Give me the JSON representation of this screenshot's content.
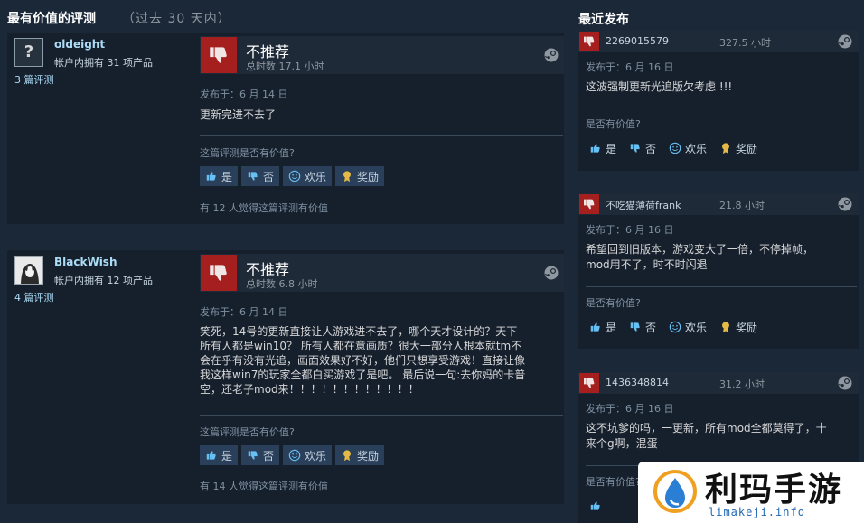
{
  "helpful_section": {
    "title": "最有价值的评测",
    "subtitle": "（过去 30 天内）"
  },
  "recent_section": {
    "title": "最近发布"
  },
  "reviews": [
    {
      "author": "oldeight",
      "owned": "帐户内拥有 31 项产品",
      "review_count": "3 篇评测",
      "avatar_text": "?",
      "recommendation": "不推荐",
      "hours": "总时数 17.1 小时",
      "posted": "发布于：6 月 14 日",
      "text": "更新完进不去了",
      "helpful_question": "这篇评测是否有价值?",
      "btn_yes": "是",
      "btn_no": "否",
      "btn_funny": "欢乐",
      "btn_award": "奖励",
      "helpful_count": "有 12 人觉得这篇评测有价值"
    },
    {
      "author": "BlackWish",
      "owned": "帐户内拥有 12 项产品",
      "review_count": "4 篇评测",
      "recommendation": "不推荐",
      "hours": "总时数 6.8 小时",
      "posted": "发布于：6 月 14 日",
      "text": "笑死，14号的更新直接让人游戏进不去了，哪个天才设计的？天下\n所有人都是win10？ 所有人都在意画质？很大一部分人根本就tm不\n会在乎有没有光追，画面效果好不好，他们只想享受游戏！直接让像\n我这样win7的玩家全都白买游戏了是吧。 最后说一句:去你妈的卡普\n空，还老子mod来！！！！！！！！！！！！",
      "helpful_question": "这篇评测是否有价值?",
      "btn_yes": "是",
      "btn_no": "否",
      "btn_funny": "欢乐",
      "btn_award": "奖励",
      "helpful_count": "有 14 人觉得这篇评测有价值"
    }
  ],
  "recent": [
    {
      "name": "2269015579",
      "hours": "327.5 小时",
      "posted": "发布于：6 月 16 日",
      "text": "这波强制更新光追版欠考虑 !!!",
      "question": "是否有价值?",
      "btn_yes": "是",
      "btn_no": "否",
      "btn_funny": "欢乐",
      "btn_award": "奖励"
    },
    {
      "name": "不吃猫薄荷frank",
      "hours": "21.8 小时",
      "posted": "发布于：6 月 16 日",
      "text": "希望回到旧版本，游戏变大了一倍，不停掉帧，\nmod用不了，时不时闪退",
      "question": "是否有价值?",
      "btn_yes": "是",
      "btn_no": "否",
      "btn_funny": "欢乐",
      "btn_award": "奖励"
    },
    {
      "name": "1436348814",
      "hours": "31.2 小时",
      "posted": "发布于：6 月 16 日",
      "text": "这不坑爹的吗，一更新，所有mod全都莫得了，十\n来个g啊，混蛋",
      "question": "是否有价值?"
    }
  ],
  "watermark": {
    "title": "利玛手游",
    "url": "limakeji.info"
  },
  "colors": {
    "background": "#1b2838",
    "panel": "#16202d",
    "not_recommended": "#a61f1f",
    "link": "#acdbf5",
    "button": "#2a3f5a"
  }
}
